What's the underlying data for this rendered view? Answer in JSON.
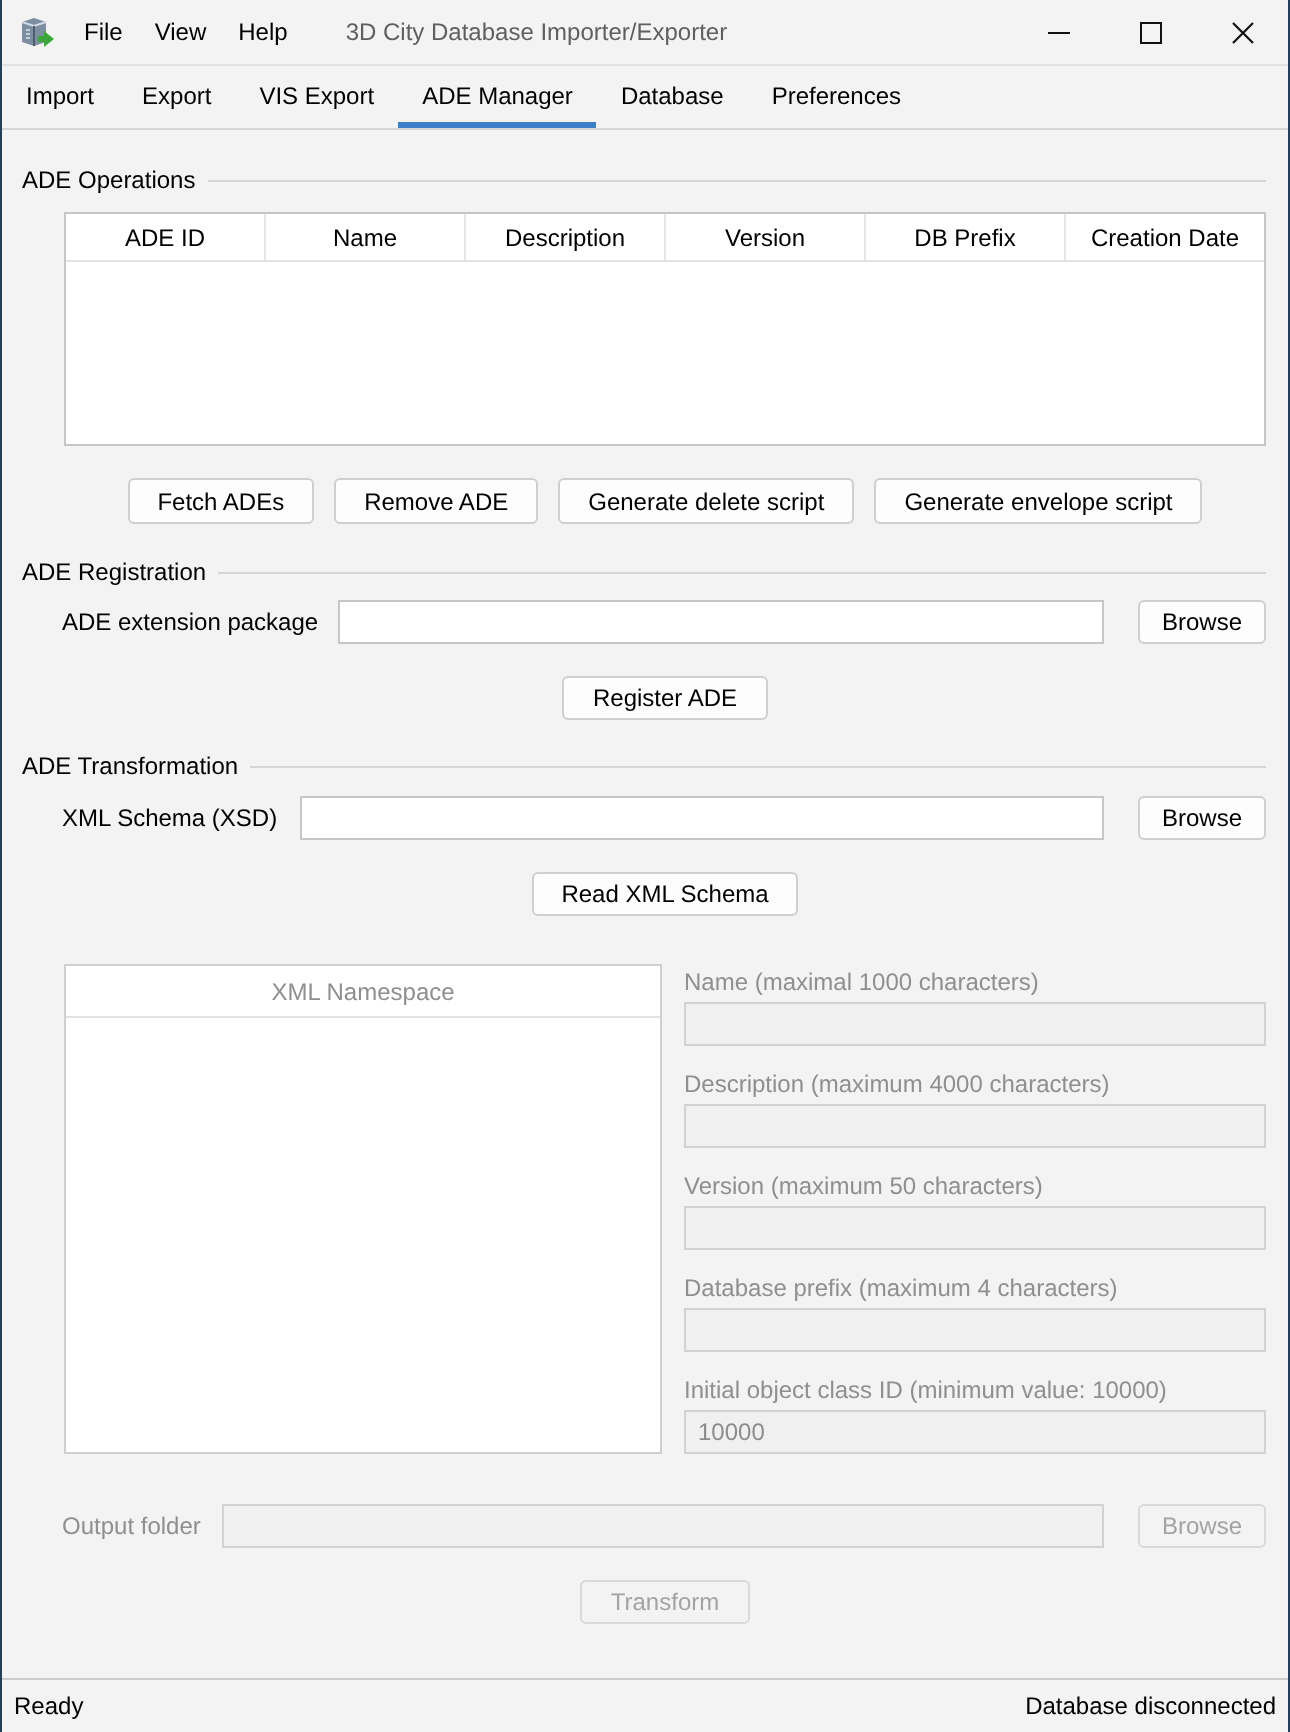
{
  "window": {
    "title": "3D City Database Importer/Exporter"
  },
  "menu": [
    "File",
    "View",
    "Help"
  ],
  "tabs": [
    {
      "label": "Import",
      "selected": false
    },
    {
      "label": "Export",
      "selected": false
    },
    {
      "label": "VIS Export",
      "selected": false
    },
    {
      "label": "ADE Manager",
      "selected": true
    },
    {
      "label": "Database",
      "selected": false
    },
    {
      "label": "Preferences",
      "selected": false
    }
  ],
  "ade_operations": {
    "title": "ADE Operations",
    "table": {
      "columns": [
        "ADE ID",
        "Name",
        "Description",
        "Version",
        "DB Prefix",
        "Creation Date"
      ]
    },
    "buttons": [
      {
        "label": "Fetch ADEs",
        "disabled": false
      },
      {
        "label": "Remove ADE",
        "disabled": false
      },
      {
        "label": "Generate delete script",
        "disabled": false
      },
      {
        "label": "Generate envelope script",
        "disabled": false
      }
    ]
  },
  "ade_registration": {
    "title": "ADE Registration",
    "package_field": {
      "label": "ADE extension package",
      "disabled": false
    },
    "browse_button": {
      "label": "Browse",
      "disabled": false
    },
    "register_button": {
      "label": "Register ADE",
      "disabled": false
    }
  },
  "ade_transformation": {
    "title": "ADE Transformation",
    "schema_field": {
      "label": "XML Schema (XSD)",
      "disabled": false
    },
    "browse_button": {
      "label": "Browse",
      "disabled": false
    },
    "read_button": {
      "label": "Read XML Schema",
      "disabled": false
    },
    "namespace_table": {
      "columns": [
        "XML Namespace"
      ],
      "disabled": true
    },
    "fields": [
      {
        "label": "Name (maximal 1000 characters)",
        "disabled": true
      },
      {
        "label": "Description (maximum 4000 characters)",
        "disabled": true
      },
      {
        "label": "Version (maximum 50 characters)",
        "disabled": true
      },
      {
        "label": "Database prefix (maximum 4 characters)",
        "disabled": true
      },
      {
        "label": "Initial object class ID (minimum value: 10000)",
        "value": "10000",
        "disabled": true
      }
    ],
    "output_field": {
      "label": "Output folder",
      "disabled": true
    },
    "output_browse_button": {
      "label": "Browse",
      "disabled": true
    },
    "transform_button": {
      "label": "Transform",
      "disabled": true
    }
  },
  "status_bar": {
    "left": "Ready",
    "right": "Database disconnected"
  }
}
